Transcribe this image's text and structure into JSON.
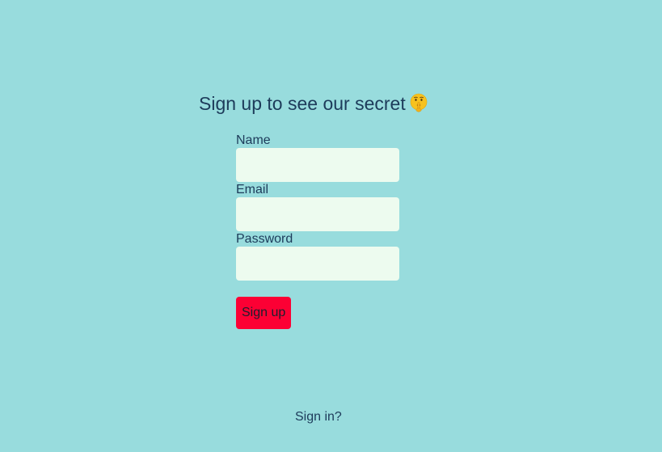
{
  "page": {
    "title": "Sign up to see our secret",
    "title_icon": "shushing-face-icon"
  },
  "form": {
    "fields": [
      {
        "label": "Name",
        "value": "",
        "type": "text"
      },
      {
        "label": "Email",
        "value": "",
        "type": "email"
      },
      {
        "label": "Password",
        "value": "",
        "type": "password"
      }
    ],
    "submit_label": "Sign up"
  },
  "footer": {
    "signin_link": "Sign in?"
  },
  "colors": {
    "background": "#98dcdd",
    "text": "#1d3b5a",
    "input_bg": "#edfbef",
    "button_bg": "#fc0034"
  }
}
